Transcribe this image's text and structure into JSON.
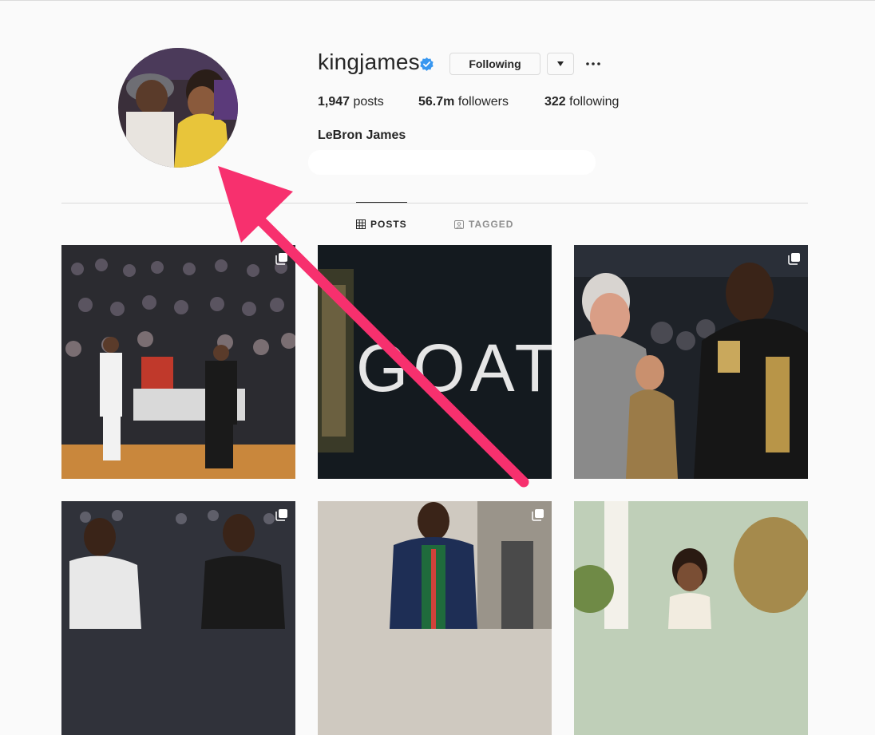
{
  "profile": {
    "username": "kingjames",
    "full_name": "LeBron James",
    "follow_button_label": "Following",
    "stats": {
      "posts_count": "1,947",
      "posts_label": "posts",
      "followers_count": "56.7m",
      "followers_label": "followers",
      "following_count": "322",
      "following_label": "following"
    }
  },
  "tabs": [
    {
      "label": "POSTS",
      "icon": "grid-icon",
      "active": true
    },
    {
      "label": "TAGGED",
      "icon": "tagged-icon",
      "active": false
    }
  ],
  "posts": [
    {
      "kind": "basketball handshake courtside",
      "multi": true
    },
    {
      "kind": "GOAT sign dark wall",
      "text": "GOAT",
      "multi": false
    },
    {
      "kind": "handshake with older man",
      "multi": true
    },
    {
      "kind": "players greeting on court",
      "multi": true
    },
    {
      "kind": "man in green jacket tunnel",
      "multi": true
    },
    {
      "kind": "child outdoors",
      "multi": false
    }
  ],
  "annotation": {
    "color": "#f7306e",
    "shape": "arrow pointing to profile picture"
  },
  "colors": {
    "verified": "#3897f0",
    "border": "#dbdbdb",
    "text": "#262626",
    "muted": "#8e8e8e"
  }
}
